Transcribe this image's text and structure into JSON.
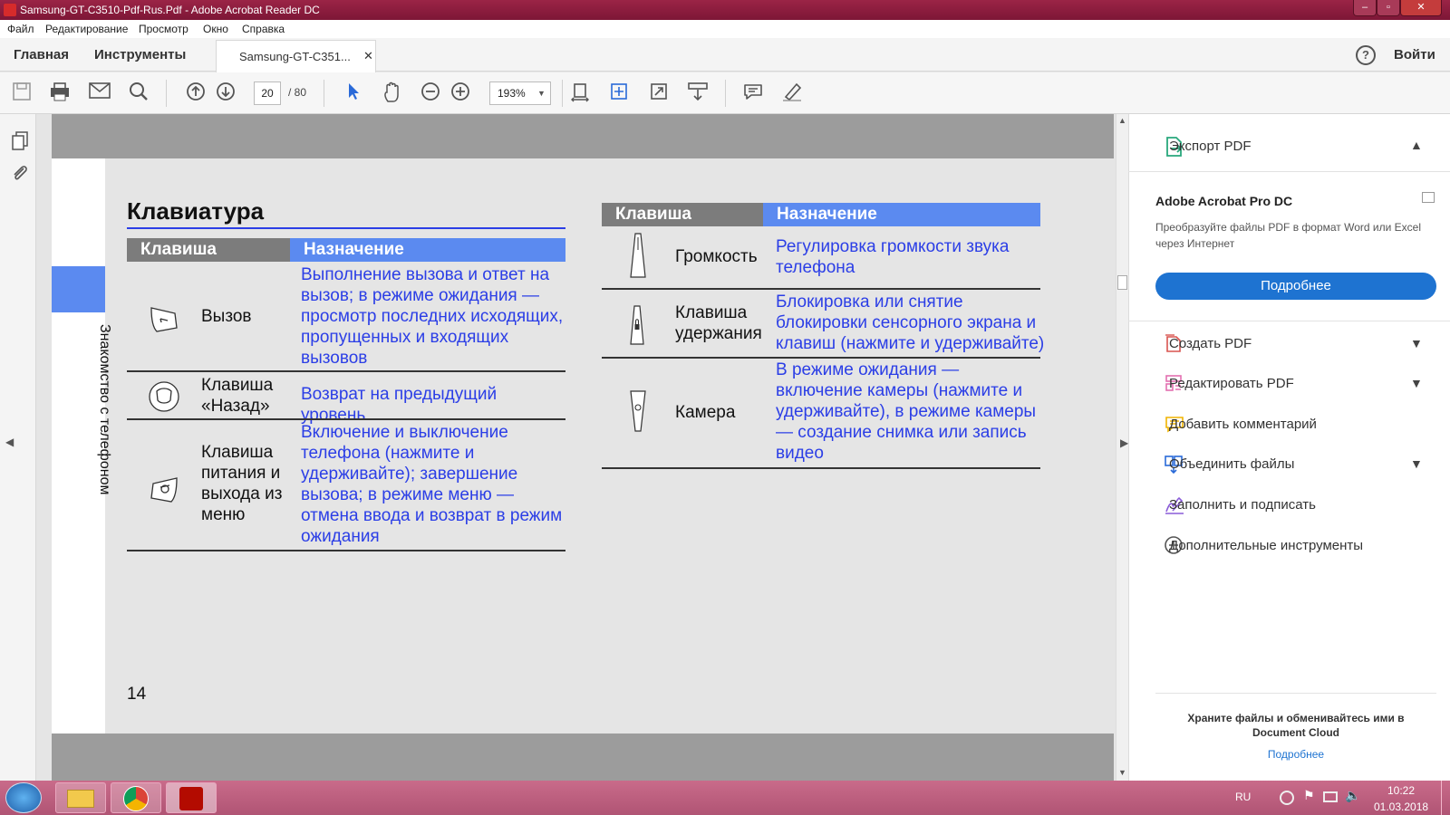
{
  "window": {
    "title": "Samsung-GT-C3510-Pdf-Rus.Pdf - Adobe Acrobat Reader DC",
    "minimize": "‒",
    "maximize": "▫",
    "close": "✕"
  },
  "menu": [
    "Файл",
    "Редактирование",
    "Просмотр",
    "Окно",
    "Справка"
  ],
  "tabs": {
    "home": "Главная",
    "tools": "Инструменты",
    "doc": "Samsung-GT-C351...",
    "close": "✕",
    "help": "?",
    "login": "Войти"
  },
  "toolbar": {
    "page_current": "20",
    "page_total": "/ 80",
    "zoom": "193%"
  },
  "document": {
    "side_label": "Знакомство с телефоном",
    "heading": "Клавиатура",
    "col_key": "Клавиша",
    "col_purpose": "Назначение",
    "page_number": "14",
    "left_rows": [
      {
        "key": "Вызов",
        "purpose": "Выполнение вызова и ответ на вызов; в режиме ожидания — просмотр последних исходящих, пропущенных и входящих вызовов"
      },
      {
        "key": "Клавиша «Назад»",
        "purpose": "Возврат на предыдущий уровень"
      },
      {
        "key": "Клавиша питания и выхода из меню",
        "purpose": "Включение и выключение телефона (нажмите и удерживайте); завершение вызова; в режиме меню — отмена ввода и возврат в режим ожидания"
      }
    ],
    "right_rows": [
      {
        "key": "Громкость",
        "purpose": "Регулировка громкости звука телефона"
      },
      {
        "key": "Клавиша удержания",
        "purpose": "Блокировка или снятие блокировки сенсорного экрана и клавиш (нажмите и удерживайте)"
      },
      {
        "key": "Камера",
        "purpose": "В режиме ожидания — включение камеры (нажмите и удерживайте), в режиме камеры — создание снимка или запись видео"
      }
    ]
  },
  "right_panel": {
    "export": "Экспорт PDF",
    "product": "Adobe Acrobat Pro DC",
    "desc": "Преобразуйте файлы PDF в формат Word или Excel через Интернет",
    "more_button": "Подробнее",
    "items": [
      "Создать PDF",
      "Редактировать PDF",
      "Добавить комментарий",
      "Объединить файлы",
      "Заполнить и подписать",
      "Дополнительные инструменты"
    ],
    "cloud_text": "Храните файлы и обменивайтесь ими в Document Cloud",
    "cloud_link": "Подробнее"
  },
  "taskbar": {
    "lang": "RU",
    "time": "10:22",
    "date": "01.03.2018"
  },
  "colors": {
    "accent_blue": "#5b8af0",
    "button_blue": "#1e73d1",
    "title_bar": "#8a1a3a"
  }
}
